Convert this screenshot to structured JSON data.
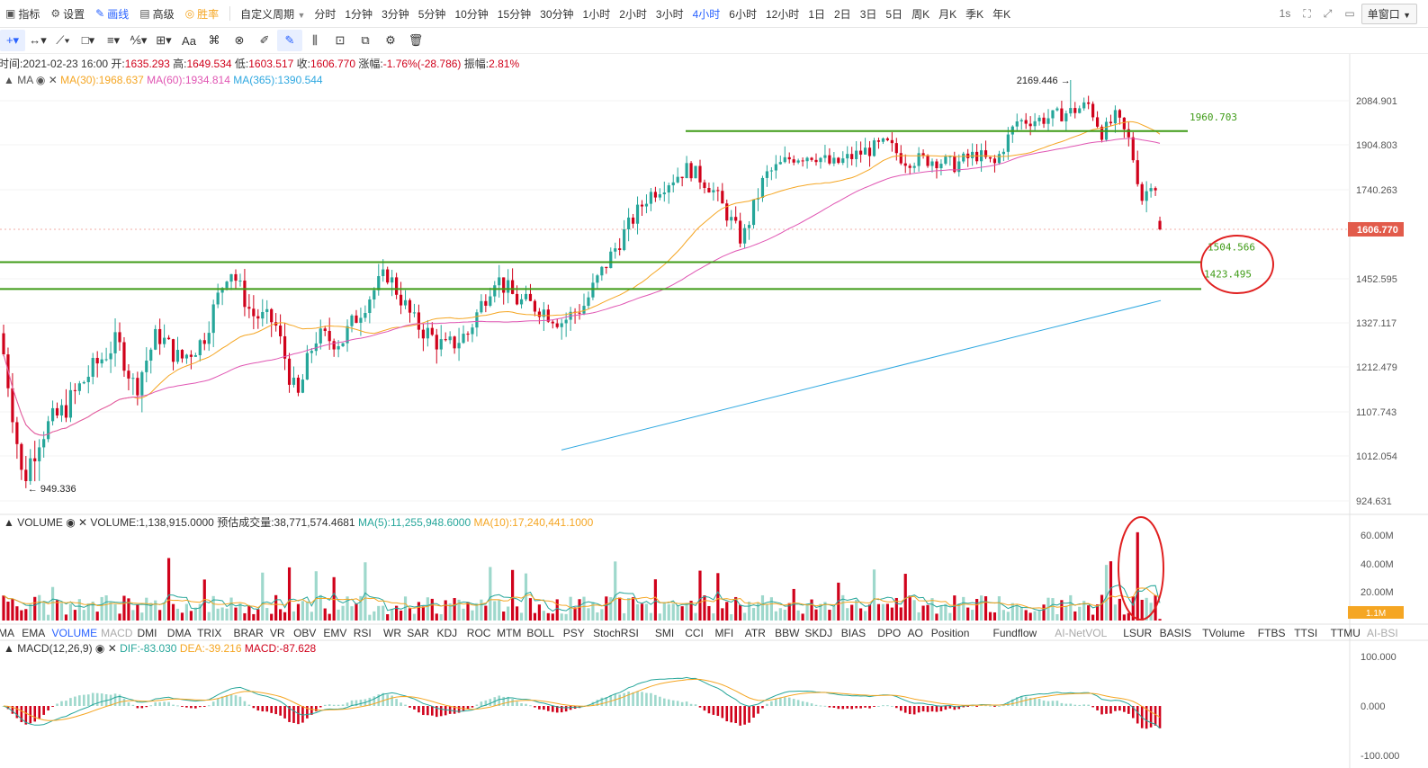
{
  "toolbar": {
    "buttons": [
      {
        "icon": "chart-icon",
        "label": "指标"
      },
      {
        "icon": "gear-icon",
        "label": "设置"
      },
      {
        "icon": "pen-icon",
        "label": "画线"
      },
      {
        "icon": "advanced-icon",
        "label": "高级"
      },
      {
        "icon": "trophy-icon",
        "label": "胜率"
      }
    ],
    "custom_period": "自定义周期",
    "periods": [
      "分时",
      "1分钟",
      "3分钟",
      "5分钟",
      "10分钟",
      "15分钟",
      "30分钟",
      "1小时",
      "2小时",
      "3小时",
      "4小时",
      "6小时",
      "12小时",
      "1日",
      "2日",
      "3日",
      "5日",
      "周K",
      "月K",
      "季K",
      "年K"
    ],
    "active_period": "4小时",
    "right_interval": "1s",
    "window_mode": "单窗口"
  },
  "ohlc": {
    "time_label": "时间:",
    "time": "2021-02-23 16:00",
    "open_label": "开:",
    "open": "1635.293",
    "high_label": "高:",
    "high": "1649.534",
    "low_label": "低:",
    "low": "1603.517",
    "close_label": "收:",
    "close": "1606.770",
    "change_label": "涨幅:",
    "change": "-1.76%(-28.786)",
    "amp_label": "振幅:",
    "amp": "2.81%"
  },
  "ma_legend": {
    "name": "MA",
    "ma30": "MA(30):1968.637",
    "ma60": "MA(60):1934.814",
    "ma365": "MA(365):1390.544"
  },
  "price_axis": [
    "2084.901",
    "1904.803",
    "1740.263",
    "1606.770",
    "1452.595",
    "1327.117",
    "1212.479",
    "1107.743",
    "1012.054",
    "924.631"
  ],
  "price_annotations": {
    "high": "2169.446",
    "low": "949.336",
    "h1": "1960.703",
    "h2": "1504.566",
    "h3": "1423.495"
  },
  "current_price": "1606.770",
  "volume_legend": {
    "name": "VOLUME",
    "value": "VOLUME:1,138,915.0000",
    "est": "预估成交量:38,771,574.4681",
    "ma5": "MA(5):11,255,948.6000",
    "ma10": "MA(10):17,240,441.1000"
  },
  "volume_axis": [
    "60.00M",
    "40.00M",
    "20.00M"
  ],
  "volume_current": "1.1M",
  "indicator_tabs": [
    "MA",
    "EMA",
    "VOLUME",
    "MACD",
    "DMI",
    "DMA",
    "TRIX",
    "BRAR",
    "VR",
    "OBV",
    "EMV",
    "RSI",
    "WR",
    "SAR",
    "KDJ",
    "ROC",
    "MTM",
    "BOLL",
    "PSY",
    "StochRSI",
    "SMI",
    "CCI",
    "MFI",
    "ATR",
    "BBW",
    "SKDJ",
    "BIAS",
    "DPO",
    "AO",
    "Position",
    "Fundflow",
    "AI-NetVOL",
    "LSUR",
    "BASIS",
    "TVolume",
    "FTBS",
    "TTSI",
    "TTMU",
    "AI-BSI"
  ],
  "active_indicator": "VOLUME",
  "macd_legend": {
    "name": "MACD(12,26,9)",
    "dif": "DIF:-83.030",
    "dea": "DEA:-39.216",
    "macd": "MACD:-87.628"
  },
  "macd_axis": [
    "100.000",
    "0.000",
    "-100.000"
  ],
  "colors": {
    "up": "#26a69a",
    "down": "#d0021b",
    "ma30": "#f5a623",
    "ma60": "#e056b3",
    "ma365": "#2fa8e0",
    "hline": "#3f9b17",
    "accent": "#2962ff",
    "circle": "#e02020"
  }
}
